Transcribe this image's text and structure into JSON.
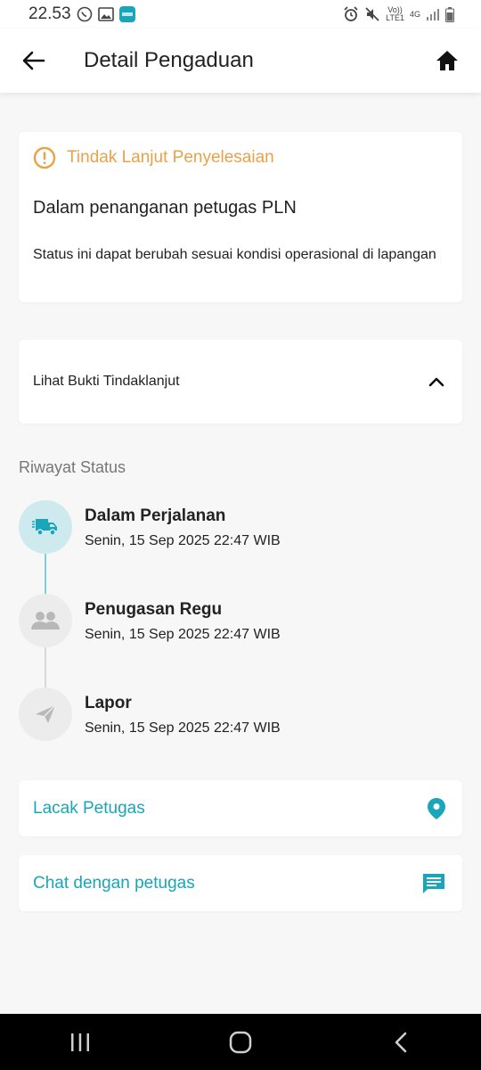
{
  "status_bar": {
    "time": "22.53",
    "network_top": "Vo))",
    "network_bottom": "LTE1",
    "signal_type": "4G"
  },
  "appbar": {
    "title": "Detail Pengaduan",
    "back_icon": "arrow-left-icon",
    "home_icon": "home-icon"
  },
  "status_card": {
    "heading": "Tindak Lanjut Penyelesaian",
    "main": "Dalam penanganan petugas PLN",
    "description": "Status ini dapat berubah sesuai kondisi operasional di lapangan",
    "heading_color": "#e8a24a"
  },
  "proof": {
    "label": "Lihat Bukti Tindaklanjut",
    "expanded": true
  },
  "history": {
    "title": "Riwayat Status",
    "items": [
      {
        "title": "Dalam Perjalanan",
        "date": "Senin, 15 Sep 2025 22:47 WIB",
        "icon": "truck-icon",
        "active": true
      },
      {
        "title": "Penugasan Regu",
        "date": "Senin, 15 Sep 2025 22:47 WIB",
        "icon": "group-icon",
        "active": false
      },
      {
        "title": "Lapor",
        "date": "Senin, 15 Sep 2025 22:47 WIB",
        "icon": "send-icon",
        "active": false
      }
    ]
  },
  "actions": {
    "track_label": "Lacak Petugas",
    "chat_label": "Chat dengan petugas",
    "accent_color": "#1aa5b8"
  }
}
